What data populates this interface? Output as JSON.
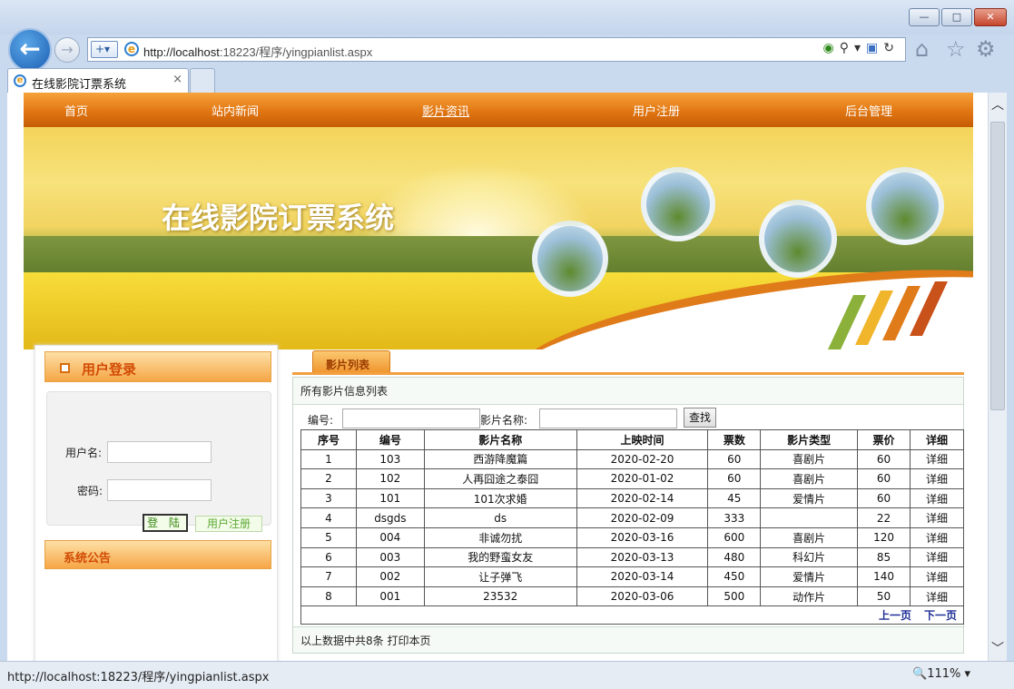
{
  "browser": {
    "url": "http://localhost:18223/程序/yingpianlist.aspx",
    "url_host": "http://localhost",
    "url_rest": ":18223/程序/yingpianlist.aspx",
    "tab_title": "在线影院订票系统",
    "status_url": "http://localhost:18223/程序/yingpianlist.aspx",
    "zoom": "111%",
    "win_min": "—",
    "win_max": "□",
    "win_close": "✕",
    "tab_close": "×"
  },
  "nav": {
    "items": [
      "首页",
      "站内新闻",
      "影片资讯",
      "用户注册",
      "后台管理"
    ]
  },
  "banner": {
    "title": "在线影院订票系统"
  },
  "login": {
    "header": "用户登录",
    "username_label": "用户名:",
    "password_label": "密码:",
    "login_button": "登 陆",
    "register_button": "用户注册"
  },
  "notice": {
    "header": "系统公告"
  },
  "movies": {
    "tab_label": "影片列表",
    "caption": "所有影片信息列表",
    "search": {
      "id_label": "编号:",
      "name_label": "影片名称:",
      "button": "查找"
    },
    "columns": [
      "序号",
      "编号",
      "影片名称",
      "上映时间",
      "票数",
      "影片类型",
      "票价",
      "详细"
    ],
    "rows": [
      [
        "1",
        "103",
        "西游降魔篇",
        "2020-02-20",
        "60",
        "喜剧片",
        "60",
        "详细"
      ],
      [
        "2",
        "102",
        "人再囧途之泰囧",
        "2020-01-02",
        "60",
        "喜剧片",
        "60",
        "详细"
      ],
      [
        "3",
        "101",
        "101次求婚",
        "2020-02-14",
        "45",
        "爱情片",
        "60",
        "详细"
      ],
      [
        "4",
        "dsgds",
        "ds",
        "2020-02-09",
        "333",
        "",
        "22",
        "详细"
      ],
      [
        "5",
        "004",
        "非诚勿扰",
        "2020-03-16",
        "600",
        "喜剧片",
        "120",
        "详细"
      ],
      [
        "6",
        "003",
        "我的野蛮女友",
        "2020-03-13",
        "480",
        "科幻片",
        "85",
        "详细"
      ],
      [
        "7",
        "002",
        "让子弹飞",
        "2020-03-14",
        "450",
        "爱情片",
        "140",
        "详细"
      ],
      [
        "8",
        "001",
        "23532",
        "2020-03-06",
        "500",
        "动作片",
        "50",
        "详细"
      ]
    ],
    "prev": "上一页",
    "next": "下一页",
    "footer": "以上数据中共8条  打印本页"
  },
  "colors": {
    "menu_orange": "#e17612",
    "header_red": "#d24b04",
    "link_blue": "#1f2f96"
  }
}
